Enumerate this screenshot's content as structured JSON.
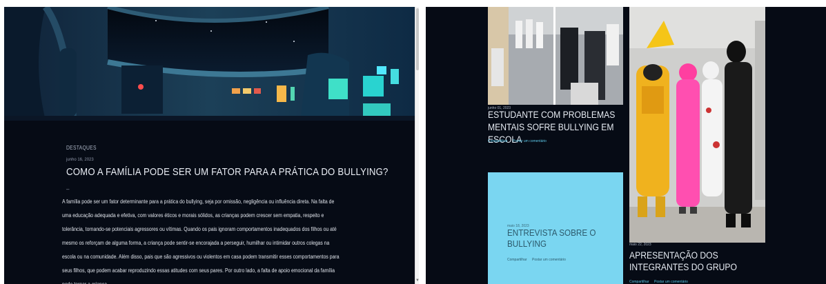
{
  "left": {
    "category": "DESTAQUES",
    "date": "junho 16, 2023",
    "title": "COMO A FAMÍLIA PODE SER UM FATOR PARA A PRÁTICA DO BULLYING?",
    "dash": "–",
    "body": "A família pode ser um fator determinante para a prática do bullying, seja por omissão, negligência ou influência direta. Na falta de uma educação adequada e efetiva, com valores éticos e morais sólidos, as crianças podem crescer sem empatia, respeito e tolerância, tornando-se potenciais agressores ou vítimas. Quando os pais ignoram comportamentos inadequados dos filhos ou até mesmo os reforçam de alguma forma, a criança pode sentir-se encorajada a perseguir, humilhar ou intimidar outros colegas na escola ou na comunidade. Além disso, pais que são agressivos ou violentos em casa podem transmitir esses comportamentos para seus filhos, que podem acabar reproduzindo essas atitudes com seus pares. Por outro lado, a falta de apoio emocional da família pode tornar a criança"
  },
  "right": {
    "post1": {
      "date": "junho 01, 2023",
      "title": "ESTUDANTE COM PROBLEMAS MENTAIS SOFRE BULLYING EM ESCOLA",
      "share": "Compartilhar",
      "comment": "Postar um comentário"
    },
    "post2": {
      "date": "maio 18, 2023",
      "title": "ENTREVISTA SOBRE O BULLYING",
      "share": "Compartilhar",
      "comment": "Postar um comentário"
    },
    "post3": {
      "date": "maio 22, 2023",
      "title": "APRESENTAÇÃO DOS INTEGRANTES DO GRUPO",
      "share": "Compartilhar",
      "comment": "Postar um comentário"
    }
  },
  "colors": {
    "background": "#060b15",
    "card": "#7ad6f1",
    "link": "#5cc8e8"
  }
}
